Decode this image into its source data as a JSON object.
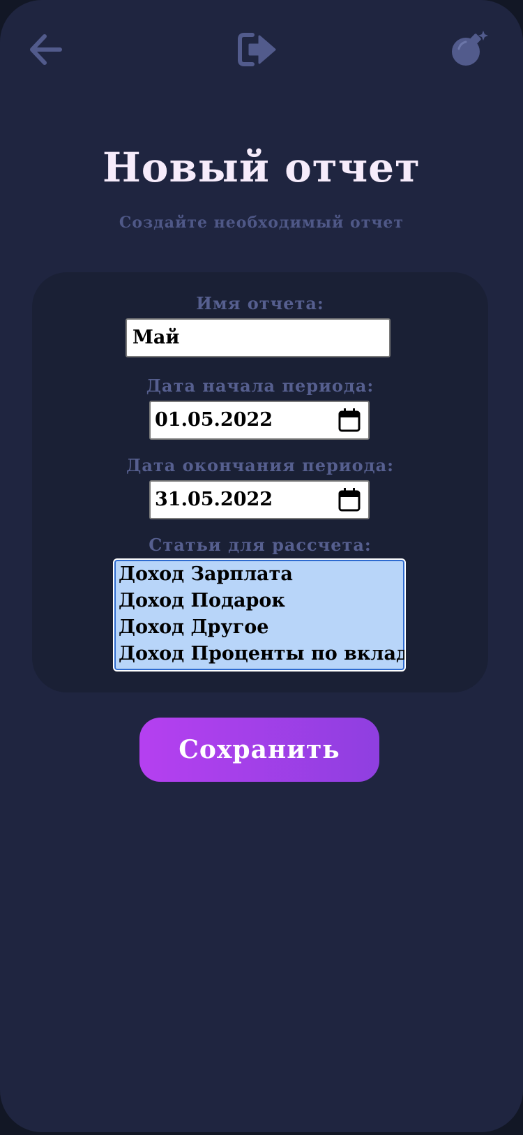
{
  "topbar": {
    "back_icon": "arrow-left-icon",
    "logout_icon": "sign-out-icon",
    "bomb_icon": "bomb-icon",
    "icon_color": "#525b8c"
  },
  "header": {
    "title": "Новый отчет",
    "subtitle": "Создайте необходимый отчет"
  },
  "form": {
    "name_label": "Имя отчета:",
    "name_value": "Май",
    "start_label": "Дата начала периода:",
    "start_value": "01.05.2022",
    "end_label": "Дата окончания периода:",
    "end_value": "31.05.2022",
    "items_label": "Статьи для рассчета:",
    "items": [
      {
        "label": "Доход Зарплата"
      },
      {
        "label": "Доход Подарок"
      },
      {
        "label": "Доход Другое"
      },
      {
        "label": "Доход Проценты по вкладу"
      }
    ]
  },
  "actions": {
    "save_label": "Сохранить"
  },
  "colors": {
    "background": "#1f2540",
    "card": "#1a2035",
    "title": "#f6ecfb",
    "muted": "#565f8f",
    "button_gradient_start": "#b540f0",
    "button_gradient_end": "#8f3fe0",
    "list_selection": "#b8d5f9"
  }
}
